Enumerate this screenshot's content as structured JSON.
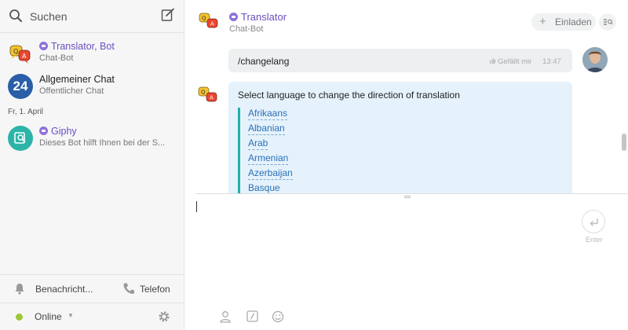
{
  "sidebar": {
    "search_label": "Suchen",
    "chats": [
      {
        "name": "Translator, Bot",
        "subtitle": "Chat-Bot",
        "is_bot": true,
        "icon": "translator-bot-icon"
      },
      {
        "name": "Allgemeiner Chat",
        "subtitle": "Öffentlicher Chat",
        "avatar_text": "24",
        "is_bot": false
      },
      {
        "name": "Giphy",
        "subtitle": "Dieses Bot hilft Ihnen bei der S...",
        "is_bot": true,
        "icon": "giphy-icon"
      }
    ],
    "date_separator": "Fr, 1. April",
    "notifications_label": "Benachricht...",
    "phone_label": "Telefon",
    "status_label": "Online"
  },
  "header": {
    "title": "Translator",
    "subtitle": "Chat-Bot",
    "invite_label": "Einladen"
  },
  "messages": {
    "own": {
      "text": "/changelang",
      "like_label": "Gefällt mir",
      "time": "13:47"
    },
    "bot": {
      "prompt": "Select language to change the direction of translation",
      "languages": [
        "Afrikaans",
        "Albanian",
        "Arab",
        "Armenian",
        "Azerbaijan",
        "Basque"
      ]
    }
  },
  "composer": {
    "enter_label": "Enter"
  },
  "colors": {
    "bot_name": "#6a4fc0",
    "link": "#2a6fb8",
    "accent_bar": "#1fb1a6",
    "bot_bubble": "#e5f2fb",
    "online": "#9ec73a"
  }
}
